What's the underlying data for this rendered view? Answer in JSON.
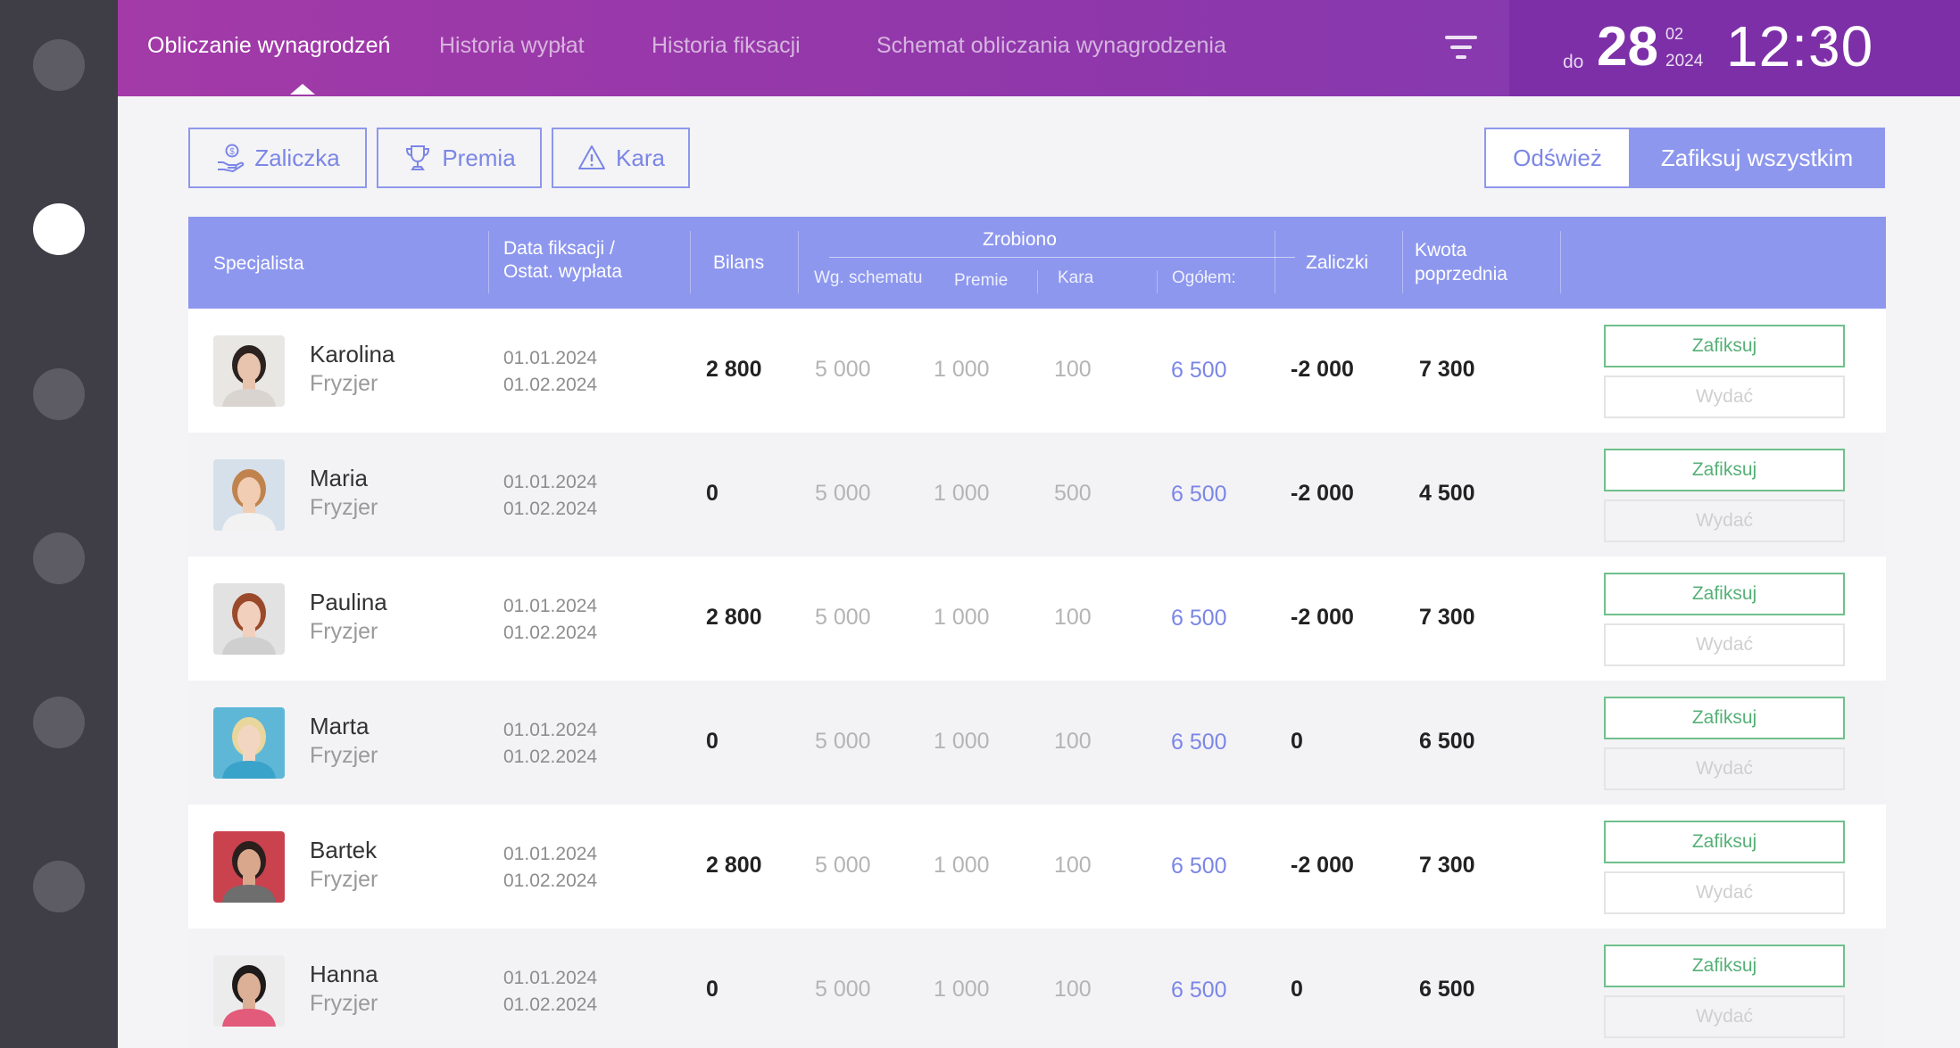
{
  "nav": {
    "tabs": [
      {
        "label": "Obliczanie wynagrodzeń",
        "active": true
      },
      {
        "label": "Historia wypłat"
      },
      {
        "label": "Historia fiksacji"
      },
      {
        "label": "Schemat obliczania wynagrodzenia"
      }
    ],
    "filter_icon": "filter-icon"
  },
  "date": {
    "prefix": "do",
    "day": "28",
    "month": "02",
    "year": "2024",
    "time": "12:30"
  },
  "toolbar": {
    "zaliczka": "Zaliczka",
    "premia": "Premia",
    "kara": "Kara",
    "refresh": "Odśwież",
    "fix_all": "Zafiksuj wszystkim"
  },
  "table": {
    "headers": {
      "specjalista": "Specjalista",
      "data_line1": "Data fiksacji /",
      "data_line2": "Ostat. wypłata",
      "bilans": "Bilans",
      "zrobiono": "Zrobiono",
      "wg_schematu": "Wg. schematu",
      "premie": "Premie",
      "kara": "Kara",
      "ogolem": "Ogółem:",
      "zaliczki": "Zaliczki",
      "kwota_line1": "Kwota",
      "kwota_line2": "poprzednia"
    },
    "rows": [
      {
        "name": "Karolina",
        "role": "Fryzjer",
        "date_fix": "01.01.2024",
        "date_pay": "01.02.2024",
        "bilans": "2 800",
        "wg": "5 000",
        "premie": "1 000",
        "kara": "100",
        "ogolem": "6 500",
        "zaliczki": "-2 000",
        "kwota": "7 300",
        "fix": "Zafiksuj",
        "pay": "Wydać"
      },
      {
        "name": "Maria",
        "role": "Fryzjer",
        "date_fix": "01.01.2024",
        "date_pay": "01.02.2024",
        "bilans": "0",
        "wg": "5 000",
        "premie": "1 000",
        "kara": "500",
        "ogolem": "6 500",
        "zaliczki": "-2 000",
        "kwota": "4 500",
        "fix": "Zafiksuj",
        "pay": "Wydać"
      },
      {
        "name": "Paulina",
        "role": "Fryzjer",
        "date_fix": "01.01.2024",
        "date_pay": "01.02.2024",
        "bilans": "2 800",
        "wg": "5 000",
        "premie": "1 000",
        "kara": "100",
        "ogolem": "6 500",
        "zaliczki": "-2 000",
        "kwota": "7 300",
        "fix": "Zafiksuj",
        "pay": "Wydać"
      },
      {
        "name": "Marta",
        "role": "Fryzjer",
        "date_fix": "01.01.2024",
        "date_pay": "01.02.2024",
        "bilans": "0",
        "wg": "5 000",
        "premie": "1 000",
        "kara": "100",
        "ogolem": "6 500",
        "zaliczki": "0",
        "kwota": "6 500",
        "fix": "Zafiksuj",
        "pay": "Wydać"
      },
      {
        "name": "Bartek",
        "role": "Fryzjer",
        "date_fix": "01.01.2024",
        "date_pay": "01.02.2024",
        "bilans": "2 800",
        "wg": "5 000",
        "premie": "1 000",
        "kara": "100",
        "ogolem": "6 500",
        "zaliczki": "-2 000",
        "kwota": "7 300",
        "fix": "Zafiksuj",
        "pay": "Wydać"
      },
      {
        "name": "Hanna",
        "role": "Fryzjer",
        "date_fix": "01.01.2024",
        "date_pay": "01.02.2024",
        "bilans": "0",
        "wg": "5 000",
        "premie": "1 000",
        "kara": "100",
        "ogolem": "6 500",
        "zaliczki": "0",
        "kwota": "6 500",
        "fix": "Zafiksuj",
        "pay": "Wydać"
      }
    ]
  },
  "colors": {
    "accent": "#8d97ee",
    "topbar": "#9a38aa",
    "fix_green": "#56b077",
    "total_blue": "#7b86e6"
  }
}
